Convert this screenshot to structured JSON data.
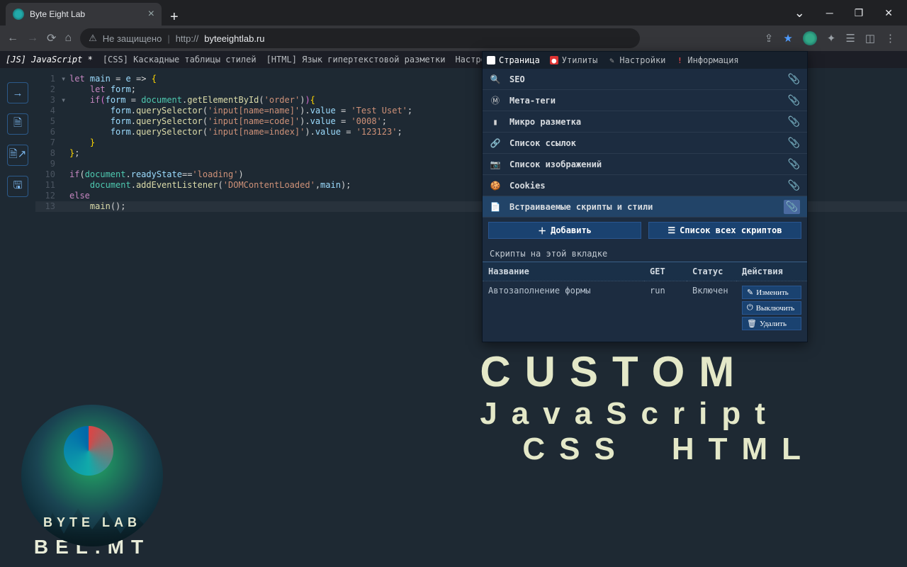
{
  "browser": {
    "tab_title": "Byte Eight Lab",
    "not_secure": "Не защищено",
    "url_prefix": "http://",
    "url": "byteeightlab.ru"
  },
  "menubar": {
    "items": [
      {
        "label": "[JS] JavaScript *"
      },
      {
        "label": "[CSS] Каскадные таблицы стилей"
      },
      {
        "label": "[HTML] Язык гипертекстовой разметки"
      },
      {
        "label": "Настройки"
      }
    ]
  },
  "code": {
    "lines": [
      {
        "n": 1,
        "fold": "▾",
        "html": "<span class='c-kw'>let</span> <span class='c-id'>main</span> <span class='c-op'>=</span> <span class='c-id'>e</span> <span class='c-op'>=&gt;</span> <span class='c-brk'>{</span>"
      },
      {
        "n": 2,
        "html": "    <span class='c-kw'>let</span> <span class='c-id'>form</span>;"
      },
      {
        "n": 3,
        "fold": "▾",
        "html": "    <span class='c-kw'>if</span><span class='c-brk2'>(</span><span class='c-id'>form</span> <span class='c-op'>=</span> <span class='c-doc'>document</span>.<span class='c-fn'>getElementById</span>(<span class='c-str'>'order'</span>)<span class='c-brk2'>)</span><span class='c-brk'>{</span>"
      },
      {
        "n": 4,
        "html": "        <span class='c-id'>form</span>.<span class='c-fn'>querySelector</span>(<span class='c-str'>'input[name=name]'</span>).<span class='c-id'>value</span> <span class='c-op'>=</span> <span class='c-str'>'Test Uset'</span>;"
      },
      {
        "n": 5,
        "html": "        <span class='c-id'>form</span>.<span class='c-fn'>querySelector</span>(<span class='c-str'>'input[name=code]'</span>).<span class='c-id'>value</span> <span class='c-op'>=</span> <span class='c-str'>'0008'</span>;"
      },
      {
        "n": 6,
        "html": "        <span class='c-id'>form</span>.<span class='c-fn'>querySelector</span>(<span class='c-str'>'input[name=index]'</span>).<span class='c-id'>value</span> <span class='c-op'>=</span> <span class='c-str'>'123123'</span>;"
      },
      {
        "n": 7,
        "html": "    <span class='c-brk'>}</span>"
      },
      {
        "n": 8,
        "html": "<span class='c-brk'>}</span>;"
      },
      {
        "n": 9,
        "html": ""
      },
      {
        "n": 10,
        "html": "<span class='c-kw'>if</span>(<span class='c-doc'>document</span>.<span class='c-id'>readyState</span><span class='c-op'>==</span><span class='c-str'>'loading'</span>)"
      },
      {
        "n": 11,
        "html": "    <span class='c-doc'>document</span>.<span class='c-fn'>addEventListener</span>(<span class='c-str'>'DOMContentLoaded'</span>,<span class='c-id'>main</span>);"
      },
      {
        "n": 12,
        "html": "<span class='c-kw'>else</span>"
      },
      {
        "n": 13,
        "hl": true,
        "html": "    <span class='c-fn'>main</span>();"
      }
    ]
  },
  "panel": {
    "tabs": [
      {
        "label": "Страница",
        "icon": "page",
        "active": true
      },
      {
        "label": "Утилиты",
        "icon": "util"
      },
      {
        "label": "Настройки",
        "icon": "set"
      },
      {
        "label": "Информация",
        "icon": "info"
      }
    ],
    "items": [
      {
        "icon": "🔍",
        "label": "SEO"
      },
      {
        "icon": "Ⓜ",
        "label": "Мета-теги",
        "ibg": "#7a4"
      },
      {
        "icon": "▮",
        "label": "Микро разметка",
        "ic": "#d80"
      },
      {
        "icon": "🔗",
        "label": "Список ссылок"
      },
      {
        "icon": "📷",
        "label": "Список изображений"
      },
      {
        "icon": "🍪",
        "label": "Cookies"
      },
      {
        "icon": "📄",
        "label": "Встраиваемые скрипты и стили",
        "sel": true
      }
    ],
    "add_label": "Добавить",
    "list_label": "Список всех скриптов",
    "section": "Скрипты на этой вкладке",
    "cols": {
      "name": "Название",
      "get": "GET",
      "status": "Статус",
      "actions": "Действия"
    },
    "row": {
      "name": "Автозаполнение формы",
      "get": "run",
      "status": "Включен"
    },
    "rowbtns": [
      {
        "icon": "✎",
        "label": "Изменить"
      },
      {
        "icon": "⏻",
        "label": "Выключить"
      },
      {
        "icon": "🗑",
        "label": "Удалить"
      }
    ]
  },
  "hero": {
    "l1": "CUSTOM",
    "l2": "JavaScript",
    "l3a": "CSS",
    "l3b": "HTML"
  },
  "logo": {
    "line1": "BYTE LAB",
    "line2": "BEL.MT"
  }
}
